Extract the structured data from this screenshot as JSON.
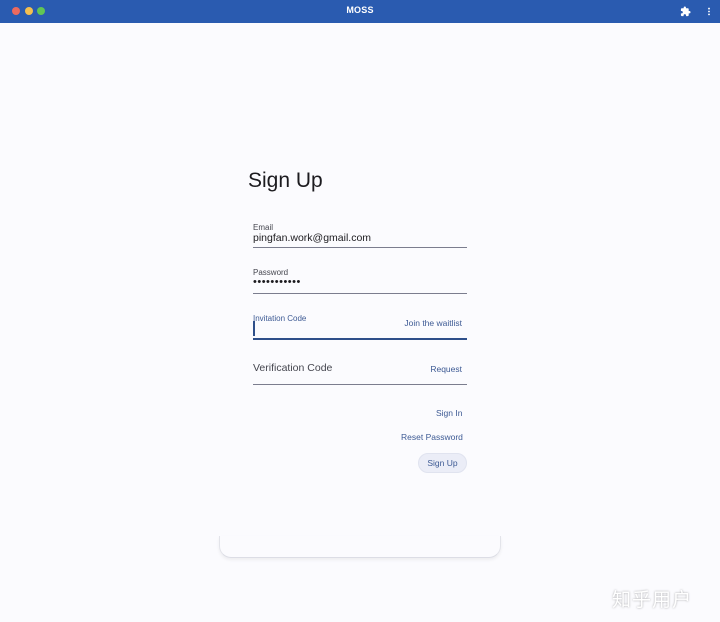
{
  "window": {
    "title": "MOSS",
    "icons": {
      "extensions": "puzzle-icon",
      "menu": "more-vertical-icon"
    }
  },
  "form": {
    "heading": "Sign Up",
    "email": {
      "label": "Email",
      "value": "pingfan.work@gmail.com"
    },
    "password": {
      "label": "Password",
      "value": "•••••••••••"
    },
    "invitation": {
      "label": "Invitation Code",
      "value": "",
      "action": "Join the waitlist"
    },
    "verification": {
      "placeholder": "Verification Code",
      "action": "Request"
    },
    "sign_in_link": "Sign In",
    "reset_link": "Reset Password",
    "sign_up_button": "Sign Up"
  },
  "watermark": "知乎用户",
  "colors": {
    "titlebar": "#2a5bb0",
    "accent": "#3d5a94",
    "background": "#fbfbfe"
  }
}
